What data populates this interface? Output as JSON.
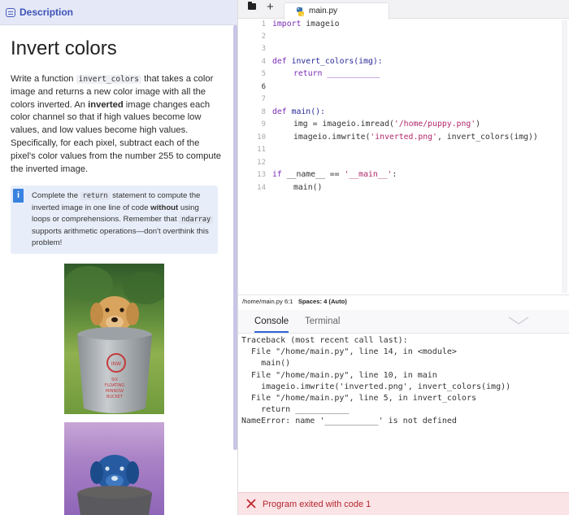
{
  "left": {
    "tab_label": "Description",
    "title": "Invert colors",
    "para": {
      "p1": "Write a function ",
      "code1": "invert_colors",
      "p2": " that takes a color image and returns a new color image with all the colors inverted. An ",
      "bold1": "inverted",
      "p3": " image changes each color channel so that if high values become low values, and low values become high values. Specifically, for each pixel, subtract each of the pixel's color values from the number 255 to compute the inverted image."
    },
    "note": {
      "badge": "i",
      "t1": "Complete the ",
      "code1": "return",
      "t2": " statement to compute the inverted image in one line of code ",
      "bold1": "without",
      "t3": " using loops or comprehensions. Remember that ",
      "code2": "ndarray",
      "t4": " supports arithmetic operations—don't overthink this problem!"
    },
    "image1": {
      "name": "puppy-original",
      "bucket_text": [
        "SIX",
        "FLOATING",
        "MINNOW",
        "BUCKET"
      ]
    },
    "image2": {
      "name": "puppy-inverted"
    }
  },
  "editor": {
    "tab_name": "main.py",
    "lines": [
      {
        "n": "1",
        "text": ""
      },
      {
        "n": "2",
        "text": ""
      },
      {
        "n": "3",
        "text": ""
      },
      {
        "n": "4",
        "text": ""
      },
      {
        "n": "5",
        "text": ""
      },
      {
        "n": "6",
        "text": ""
      },
      {
        "n": "7",
        "text": ""
      },
      {
        "n": "8",
        "text": ""
      },
      {
        "n": "9",
        "text": ""
      },
      {
        "n": "10",
        "text": ""
      },
      {
        "n": "11",
        "text": ""
      },
      {
        "n": "12",
        "text": ""
      },
      {
        "n": "13",
        "text": ""
      },
      {
        "n": "14",
        "text": ""
      }
    ],
    "active_line": "6",
    "tokens": {
      "l1_kw": "import",
      "l1_rest": " imageio",
      "l4_kw": "def",
      "l4_rest": " invert_colors(img):",
      "l5_kw": "return",
      "l5_rest": " ___________",
      "l8_kw": "def",
      "l8_rest": " main():",
      "l9_a": "img = imageio.imread(",
      "l9_str": "'/home/puppy.png'",
      "l9_b": ")",
      "l10_a": "imageio.imwrite(",
      "l10_str": "'inverted.png'",
      "l10_b": ", invert_colors(img))",
      "l13_kw": "if",
      "l13_a": " __name__ == ",
      "l13_str": "'__main__'",
      "l13_b": ":",
      "l14": "main()"
    }
  },
  "statusbar": {
    "path": "/home/main.py",
    "pos": "6:1",
    "spaces": "Spaces: 4 (Auto)"
  },
  "console": {
    "tabs": [
      "Console",
      "Terminal"
    ],
    "output": "Traceback (most recent call last):\n  File \"/home/main.py\", line 14, in <module>\n    main()\n  File \"/home/main.py\", line 10, in main\n    imageio.imwrite('inverted.png', invert_colors(img))\n  File \"/home/main.py\", line 5, in invert_colors\n    return ___________\nNameError: name '___________' is not defined",
    "exit_message": "Program exited with code 1"
  },
  "colors": {
    "accent": "#3c52b8",
    "keyword": "#7a2bb5",
    "string": "#b1276b",
    "error_bg": "#fbe4e6",
    "error_text": "#b3262f"
  }
}
